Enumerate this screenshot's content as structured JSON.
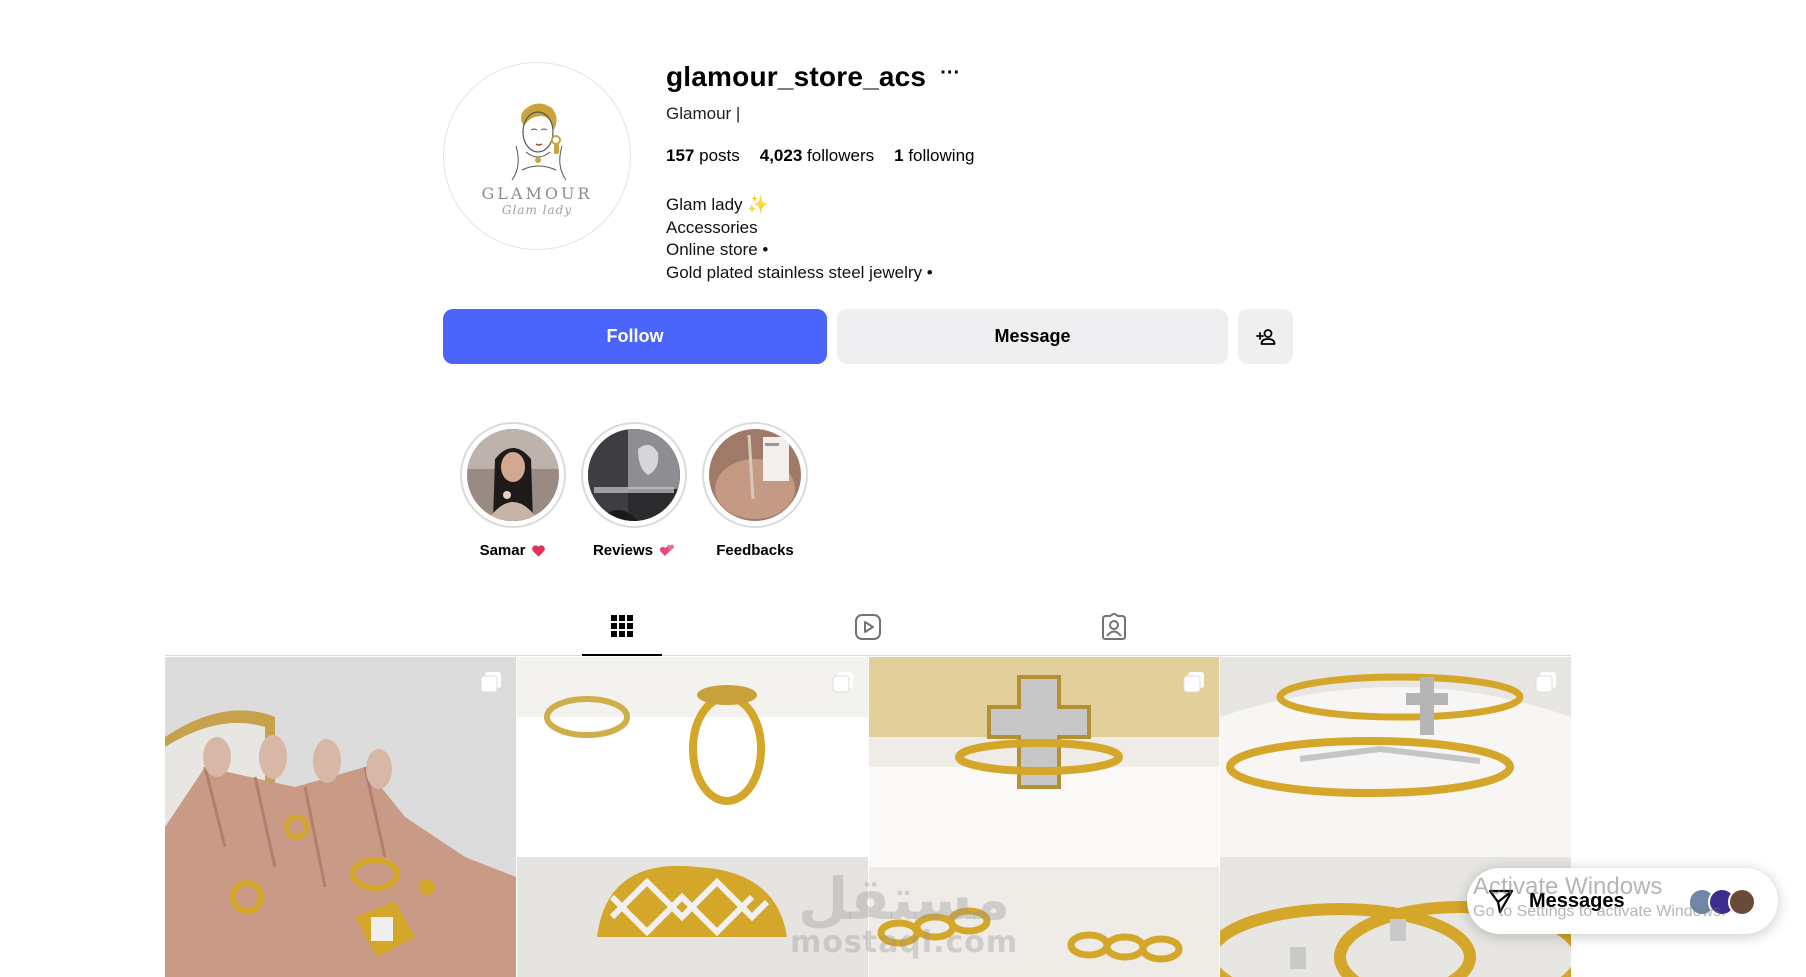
{
  "profile": {
    "username": "glamour_store_acs",
    "full_name": "Glamour |",
    "avatar_brand": "GLAMOUR",
    "avatar_brand_sub": "Glam lady",
    "stats": {
      "posts_count": "157",
      "posts_label": "posts",
      "followers_count": "4,023",
      "followers_label": "followers",
      "following_count": "1",
      "following_label": "following"
    },
    "bio": [
      "Glam lady ✨",
      "Accessories",
      "Online store •",
      "Gold plated stainless steel jewelry •"
    ]
  },
  "actions": {
    "follow_label": "Follow",
    "message_label": "Message",
    "add_user_icon": "person-add-icon"
  },
  "highlights": [
    {
      "label": "Samar",
      "emoji": "❤️"
    },
    {
      "label": "Reviews",
      "emoji": "💕"
    },
    {
      "label": "Feedbacks",
      "emoji": ""
    }
  ],
  "tabs": [
    {
      "icon": "grid-icon",
      "active": true
    },
    {
      "icon": "reels-icon",
      "active": false
    },
    {
      "icon": "tagged-icon",
      "active": false
    }
  ],
  "watermark": {
    "arabic": "مستقل",
    "latin": "mostaql.com"
  },
  "messages_widget": {
    "label": "Messages"
  },
  "os_overlay": {
    "line1": "Activate Windows",
    "line2": "Go to Settings to activate Windows."
  },
  "colors": {
    "follow_button": "#4a64fc",
    "secondary_button": "#efeff2",
    "gold": "#d4a62a"
  }
}
